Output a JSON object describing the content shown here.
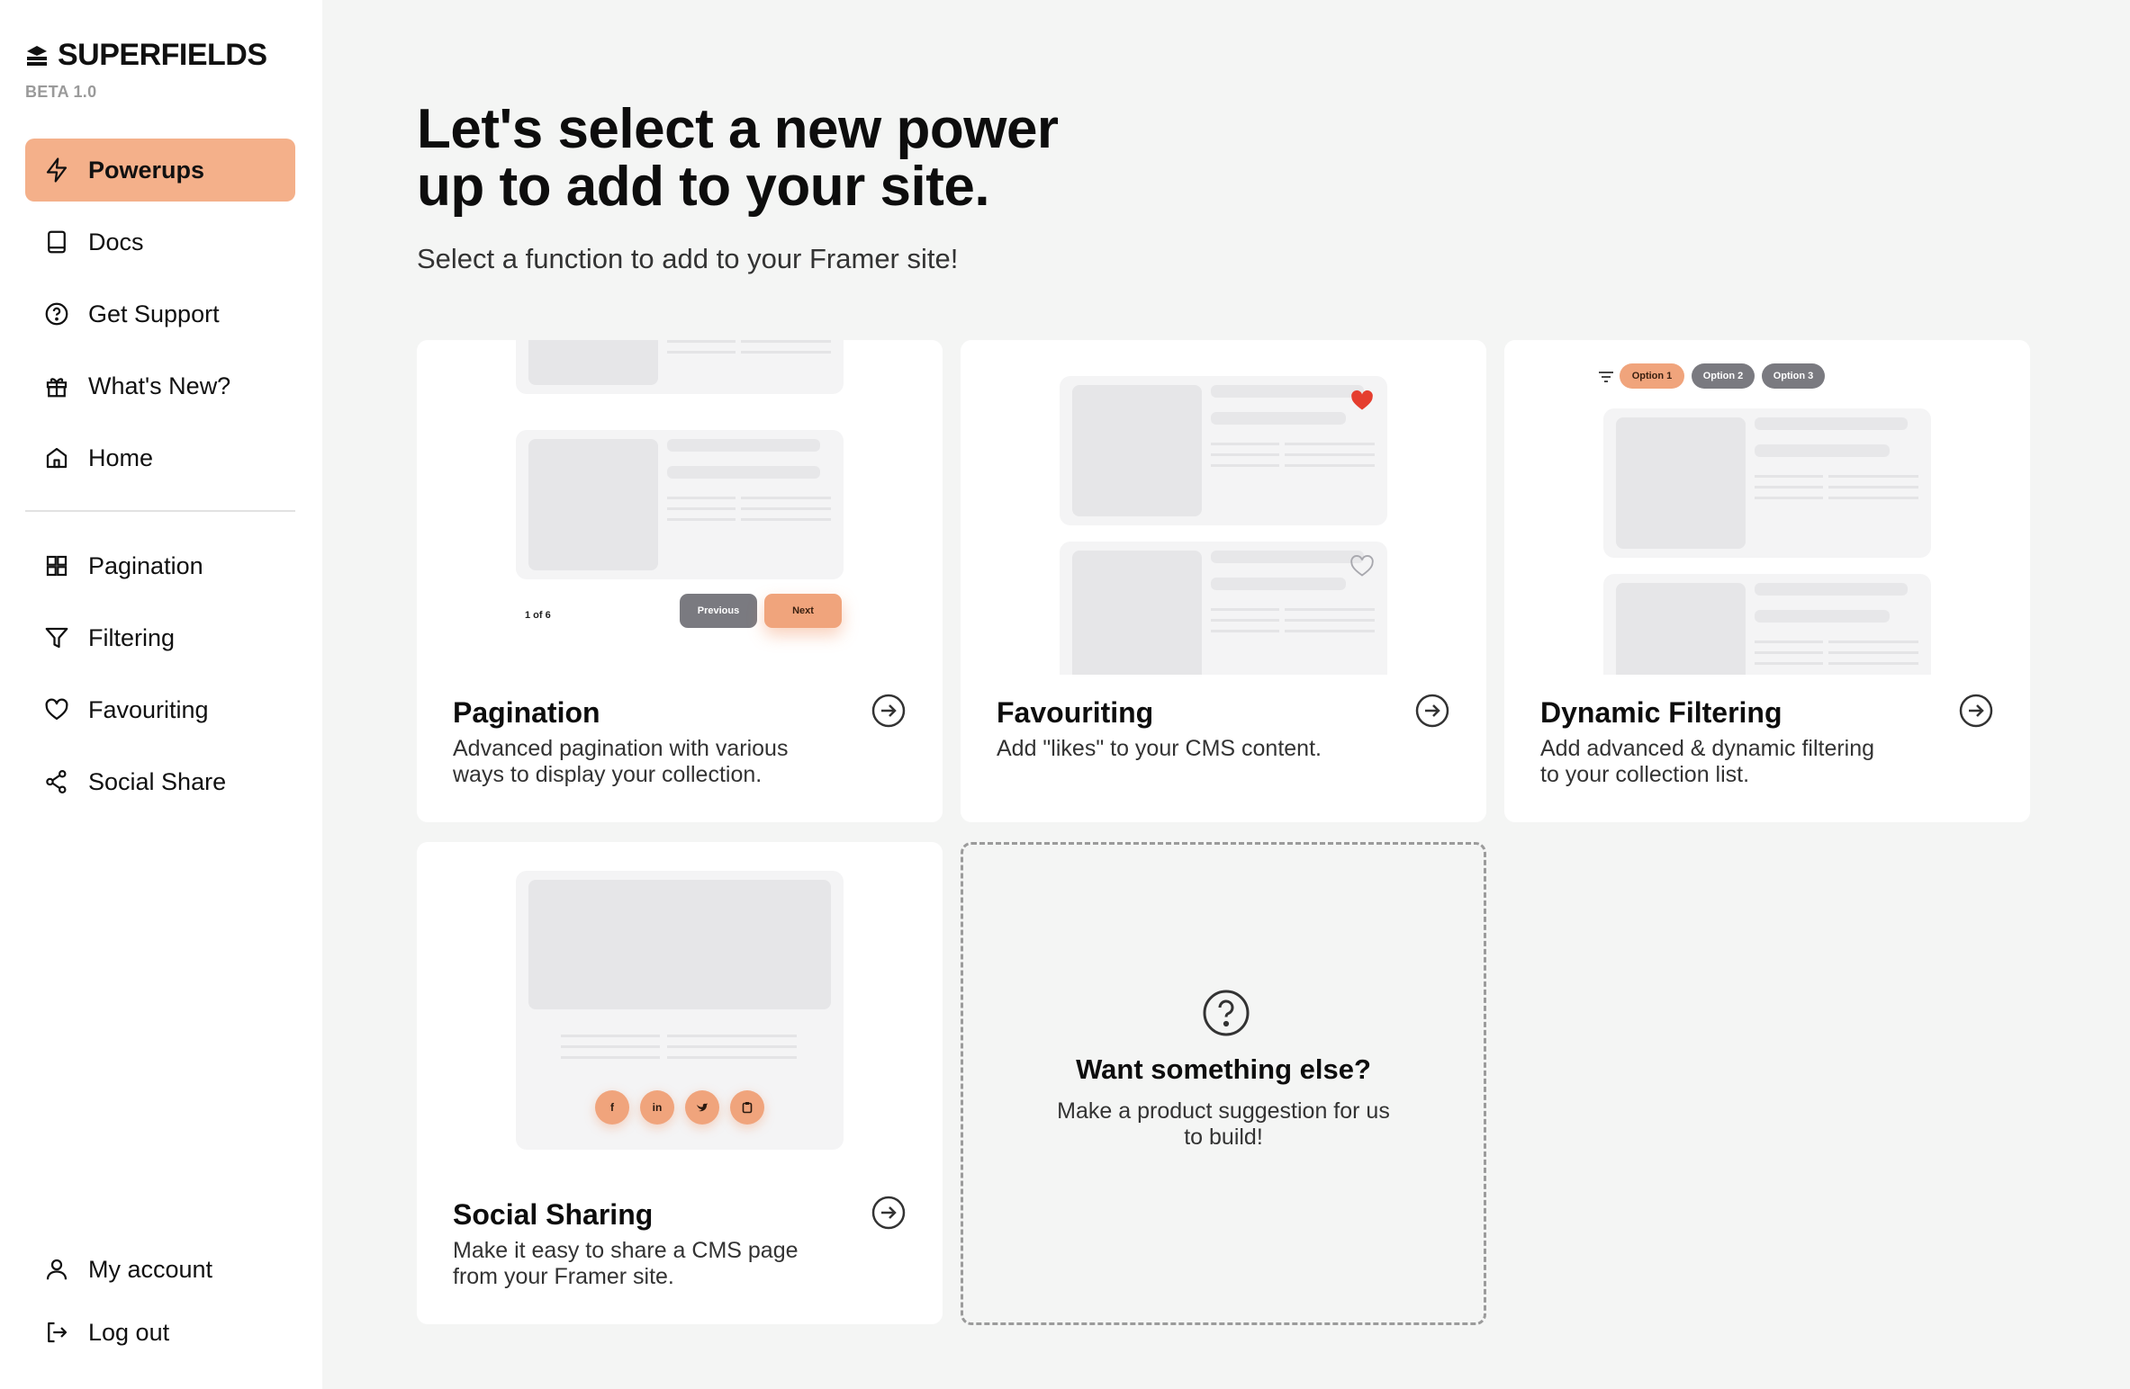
{
  "brand": {
    "name": "SUPERFIELDS",
    "version": "BETA 1.0"
  },
  "sidebar": {
    "items": [
      {
        "label": "Powerups",
        "icon": "lightning-icon",
        "active": true
      },
      {
        "label": "Docs",
        "icon": "book-icon"
      },
      {
        "label": "Get Support",
        "icon": "help-circle-icon"
      },
      {
        "label": "What's New?",
        "icon": "gift-icon"
      },
      {
        "label": "Home",
        "icon": "home-icon"
      }
    ],
    "features": [
      {
        "label": "Pagination",
        "icon": "grid-icon"
      },
      {
        "label": "Filtering",
        "icon": "filter-icon"
      },
      {
        "label": "Favouriting",
        "icon": "heart-icon"
      },
      {
        "label": "Social Share",
        "icon": "share-icon"
      }
    ],
    "footer": [
      {
        "label": "My account",
        "icon": "user-icon"
      },
      {
        "label": "Log out",
        "icon": "logout-icon"
      }
    ]
  },
  "main": {
    "headline_line1": "Let's select a new power",
    "headline_line2": "up to add to your site.",
    "subhead": "Select a function to add to your Framer site!"
  },
  "cards": [
    {
      "title": "Pagination",
      "desc_line1": "Advanced pagination with various",
      "desc_line2": "ways to display your collection.",
      "preview": {
        "page_text": "1 of 6",
        "prev": "Previous",
        "next": "Next"
      }
    },
    {
      "title": "Favouriting",
      "desc_line1": "Add \"likes\" to your CMS content.",
      "desc_line2": ""
    },
    {
      "title": "Dynamic Filtering",
      "desc_line1": "Add advanced & dynamic filtering",
      "desc_line2": "to your collection list.",
      "preview": {
        "options": [
          "Option 1",
          "Option 2",
          "Option 3"
        ]
      }
    },
    {
      "title": "Social Sharing",
      "desc_line1": "Make it easy to share a CMS page",
      "desc_line2": "from your Framer site."
    }
  ],
  "suggestion": {
    "title": "Want something else?",
    "desc_line1": "Make a product suggestion for us",
    "desc_line2": "to build!"
  },
  "colors": {
    "accent": "#f4b08a",
    "accent_button": "#f0a47c",
    "gray_button": "#7a7a80",
    "heart": "#e53e2f"
  }
}
